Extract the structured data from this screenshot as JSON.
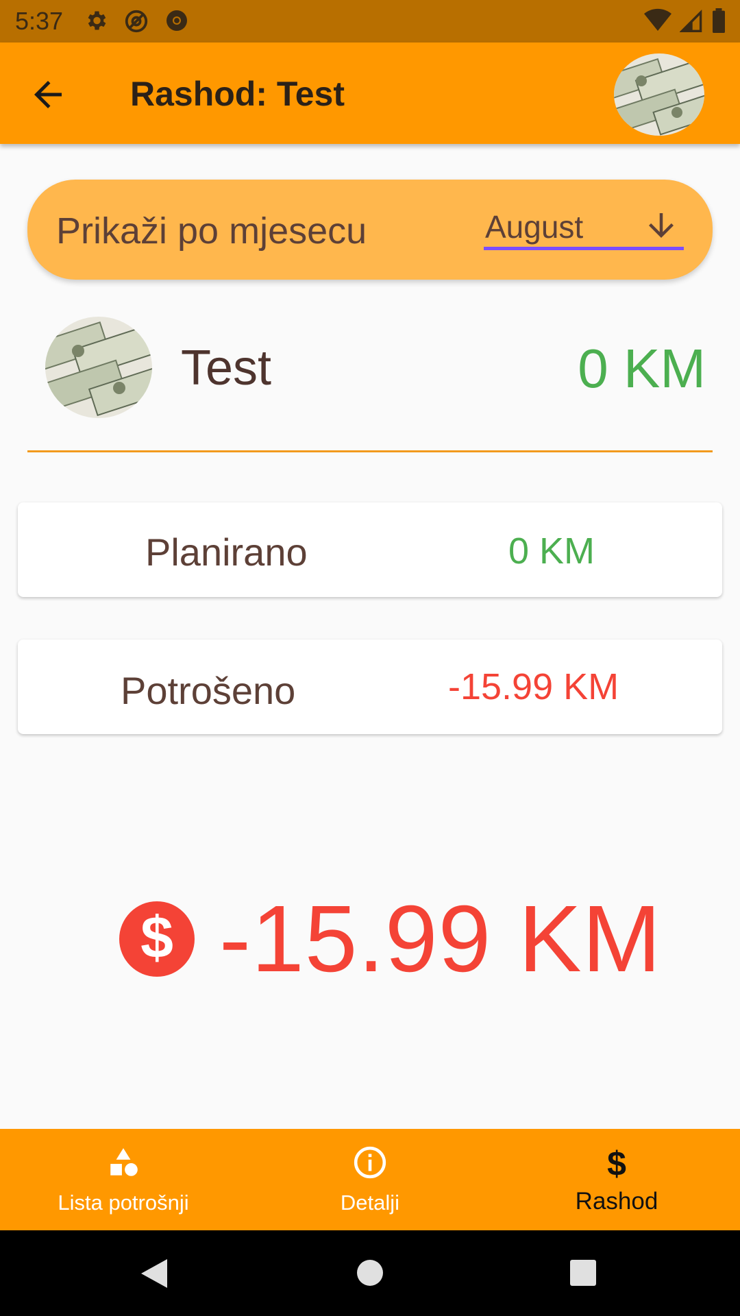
{
  "status_bar": {
    "time": "5:37",
    "icons": [
      "settings-icon",
      "at-sign-icon",
      "chrome-icon",
      "wifi-icon",
      "signal-icon",
      "battery-icon"
    ]
  },
  "app_bar": {
    "title": "Rashod: Test",
    "back_icon": "arrow-left-icon",
    "background": "#ff9800"
  },
  "month_filter": {
    "label": "Prikaži po mjesecu",
    "selected_month": "August",
    "dropdown_icon": "arrow-down-icon"
  },
  "item": {
    "name": "Test",
    "amount": "0 KM",
    "amount_color": "#4caf50"
  },
  "stats": [
    {
      "label": "Planirano",
      "value": "0 KM",
      "color": "#4caf50"
    },
    {
      "label": "Potrošeno",
      "value": "-15.99 KM",
      "color": "#f44336"
    }
  ],
  "total": {
    "value": "-15.99 KM",
    "icon": "dollar-circle-icon",
    "color": "#f44336"
  },
  "bottom_nav": {
    "items": [
      {
        "label": "Lista potrošnji",
        "icon": "shapes-icon",
        "active": false
      },
      {
        "label": "Detalji",
        "icon": "info-icon",
        "active": false
      },
      {
        "label": "Rashod",
        "icon": "dollar-icon",
        "active": true
      }
    ]
  },
  "system_nav": {
    "buttons": [
      "back-triangle-icon",
      "home-circle-icon",
      "recents-square-icon"
    ]
  }
}
